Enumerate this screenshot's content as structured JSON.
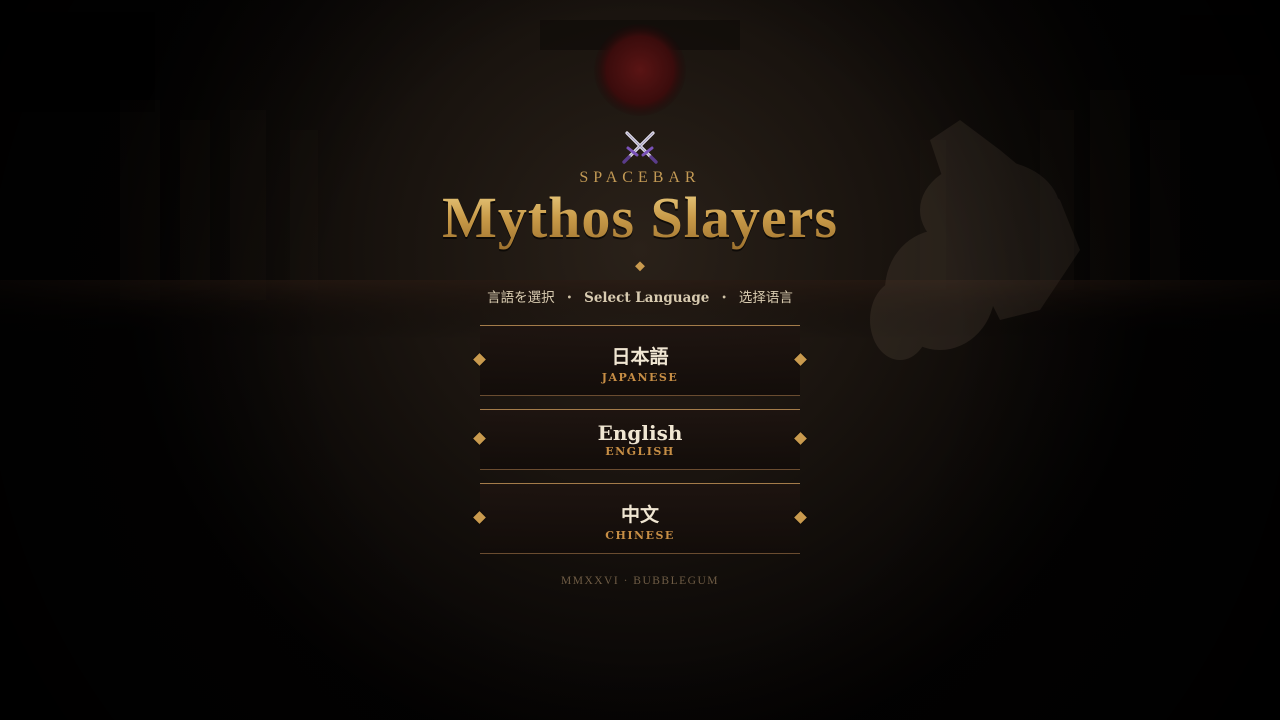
{
  "game": {
    "studio": "SPACEBAR",
    "title": "Mythos Slayers",
    "emblem_icon": "crossed-swords-icon"
  },
  "language_select": {
    "prompt_ja": "言語を選択",
    "prompt_separator": "・",
    "prompt_en": "Select Language",
    "prompt_zh": "选择语言",
    "options": [
      {
        "label": "日本語",
        "sublabel": "JAPANESE"
      },
      {
        "label": "English",
        "sublabel": "ENGLISH"
      },
      {
        "label": "中文",
        "sublabel": "CHINESE"
      }
    ]
  },
  "footer": {
    "text": "MMXXVI · BUBBLEGUM"
  },
  "colors": {
    "gold": "#c99a4e",
    "gold_light": "#f0d48a",
    "background": "#050302",
    "button_text": "#f0e6d2",
    "sublabel": "#c78e45"
  }
}
